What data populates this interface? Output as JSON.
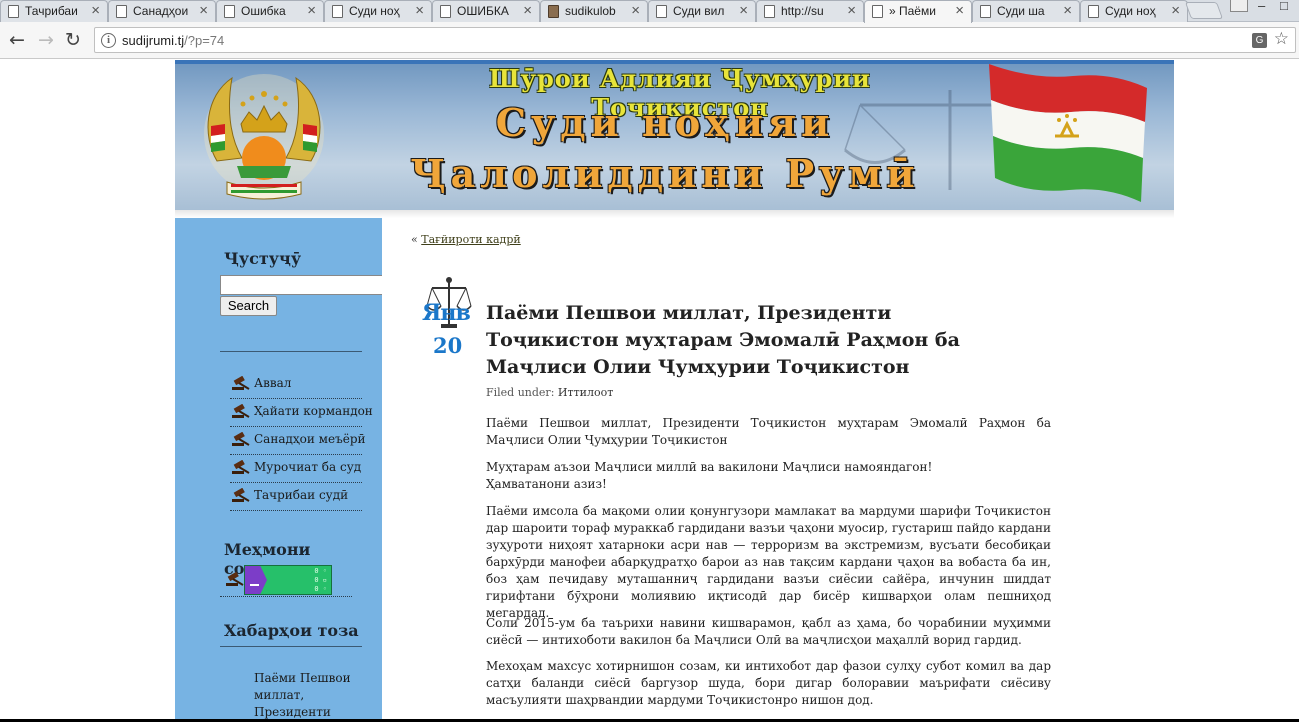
{
  "browser": {
    "tabs": [
      {
        "label": "Тачрибаи",
        "icon": "document-icon",
        "active": false
      },
      {
        "label": "Санадҳои",
        "icon": "document-icon",
        "active": false
      },
      {
        "label": "Ошибка",
        "icon": "document-icon",
        "active": false
      },
      {
        "label": "Суди ноҳ",
        "icon": "document-icon",
        "active": false
      },
      {
        "label": "ОШИБКА",
        "icon": "document-icon",
        "active": false
      },
      {
        "label": "sudikulob",
        "icon": "image-icon",
        "active": false
      },
      {
        "label": "Суди вил",
        "icon": "document-icon",
        "active": false
      },
      {
        "label": "http://su",
        "icon": "document-icon",
        "active": false
      },
      {
        "label": "» Паёми",
        "icon": "document-icon",
        "active": true
      },
      {
        "label": "Суди ша",
        "icon": "document-icon",
        "active": false
      },
      {
        "label": "Суди ноҳ",
        "icon": "document-icon",
        "active": false
      }
    ],
    "url_host": "sudijrumi.tj",
    "url_path": "/?p=74",
    "window_buttons": [
      "–",
      "□"
    ]
  },
  "header": {
    "line1": "Шӯрои Адлияи Ҷумҳурии Тоҷикистон",
    "line2": "Суди ноҳияи",
    "line3": "Ҷалолиддини Румӣ"
  },
  "sidebar": {
    "search_heading": "Ҷустуҷӯ",
    "search_button": "Search",
    "search_value": "",
    "menu": [
      "Аввал",
      "Ҳайати кормандон",
      "Санадҳои меъёрӣ",
      "Мурочиат ба суд",
      "Тачрибаи судӣ"
    ],
    "visitors_heading": "Меҳмони сомона",
    "news_heading": "Хабарҳои тоза",
    "news_item": "Паёми Пешвои миллат, Президенти"
  },
  "post": {
    "prev_arrow": "«",
    "prev_link": "Тағйироти кадрӣ",
    "date_month": "Янв",
    "date_day": "20",
    "title": "Паёми Пешвои миллат, Президенти Тоҷикистон муҳтарам Эмомалӣ Раҳмон ба Маҷлиси Олии Ҷумҳурии Тоҷикистон",
    "filed_label": "Filed under:",
    "filed_category": "Иттилоот",
    "paragraphs": [
      "Паёми Пешвои миллат, Президенти Тоҷикистон муҳтарам Эмомалӣ Раҳмон ба Маҷлиси Олии Ҷумҳурии Тоҷикистон",
      "Муҳтарам аъзои Маҷлиси миллӣ ва вакилони Маҷлиси намояндагон!",
      "Ҳамватанони азиз!",
      "Паёми имсола ба мақоми олии қонунгузори мамлакат ва мардуми шарифи Тоҷикистон дар шароити тораф мураккаб гардидани вазъи ҷаҳони муосир, густариш пайдо кардани зуҳуроти ниҳоят хатарноки асри нав — терроризм ва экстремизм, вусъати бесобиқаи бархӯрди манофеи абарқудратҳо барои аз нав тақсим кардани ҷаҳон ва вобаста ба ин, боз ҳам печидаву муташанниҷ гардидани вазъи сиёсии сайёра, инчунин шиддат гирифтани бӯҳрони молиявию иқтисодӣ дар бисёр кишварҳои олам пешниҳод мегардад.",
      "Соли 2015-ум ба таърихи навини кишварамон, қабл аз ҳама, бо чорабинии муҳимми сиёсӣ — интихоботи вакилон ба Маҷлиси Олӣ ва маҷлисҳои маҳаллӣ ворид гардид.",
      "Мехоҳам махсус хотирнишон созам, ки интихобот дар фазои сулҳу субот комил ва дар сатҳи баланди сиёсӣ баргузор шуда, бори дигар болоравии маърифати сиёсиву масъулияти шаҳрвандии мардуми Тоҷикистонро нишон дод."
    ]
  }
}
